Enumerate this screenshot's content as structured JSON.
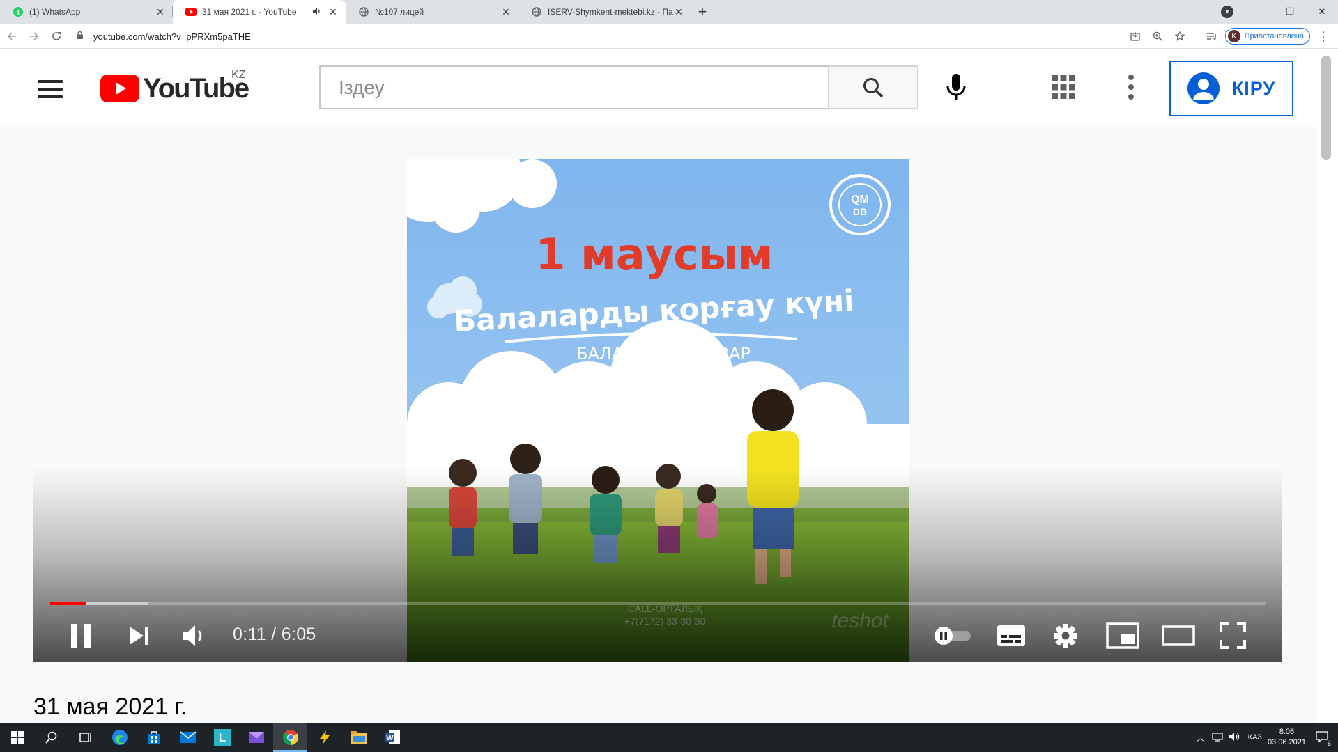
{
  "browser": {
    "tabs": [
      {
        "title": "(1) WhatsApp",
        "icon": "whatsapp-icon",
        "active": false
      },
      {
        "title": "31 мая 2021 г. - YouTube",
        "icon": "youtube-icon",
        "active": true,
        "audio": true
      },
      {
        "title": "№107 лицей",
        "icon": "globe-icon",
        "active": false
      },
      {
        "title": "ISERV-Shymkent-mektebi.kz - Па",
        "icon": "globe-icon",
        "active": false
      }
    ],
    "url": "youtube.com/watch?v=pPRXm5paTHE",
    "profile_label": "Приостановлена",
    "profile_initial": "K"
  },
  "youtube": {
    "logo_text": "YouTube",
    "region": "KZ",
    "search_placeholder": "Іздеу",
    "signin_label": "КІРУ"
  },
  "player": {
    "current_time": "0:11",
    "duration": "6:05",
    "played_fraction": 0.03,
    "buffered_fraction": 0.081,
    "colors": {
      "progress": "#ff0000"
    }
  },
  "video_date": "31 мая 2021 г.",
  "taskbar": {
    "language": "ҚАЗ",
    "time": "8:06",
    "date": "03.06.2021",
    "notification_count": "6"
  }
}
